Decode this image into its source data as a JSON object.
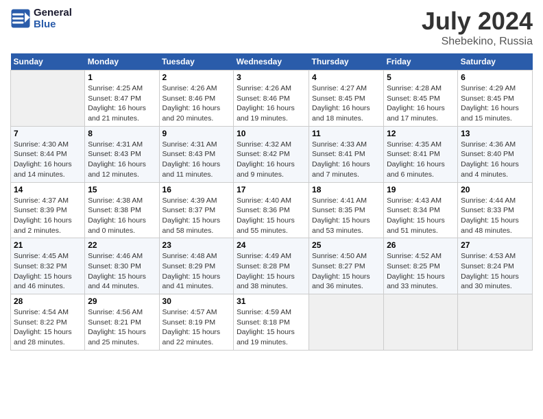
{
  "header": {
    "logo_line1": "General",
    "logo_line2": "Blue",
    "month": "July 2024",
    "location": "Shebekino, Russia"
  },
  "weekdays": [
    "Sunday",
    "Monday",
    "Tuesday",
    "Wednesday",
    "Thursday",
    "Friday",
    "Saturday"
  ],
  "weeks": [
    [
      {
        "day": "",
        "info": ""
      },
      {
        "day": "1",
        "info": "Sunrise: 4:25 AM\nSunset: 8:47 PM\nDaylight: 16 hours\nand 21 minutes."
      },
      {
        "day": "2",
        "info": "Sunrise: 4:26 AM\nSunset: 8:46 PM\nDaylight: 16 hours\nand 20 minutes."
      },
      {
        "day": "3",
        "info": "Sunrise: 4:26 AM\nSunset: 8:46 PM\nDaylight: 16 hours\nand 19 minutes."
      },
      {
        "day": "4",
        "info": "Sunrise: 4:27 AM\nSunset: 8:45 PM\nDaylight: 16 hours\nand 18 minutes."
      },
      {
        "day": "5",
        "info": "Sunrise: 4:28 AM\nSunset: 8:45 PM\nDaylight: 16 hours\nand 17 minutes."
      },
      {
        "day": "6",
        "info": "Sunrise: 4:29 AM\nSunset: 8:45 PM\nDaylight: 16 hours\nand 15 minutes."
      }
    ],
    [
      {
        "day": "7",
        "info": "Sunrise: 4:30 AM\nSunset: 8:44 PM\nDaylight: 16 hours\nand 14 minutes."
      },
      {
        "day": "8",
        "info": "Sunrise: 4:31 AM\nSunset: 8:43 PM\nDaylight: 16 hours\nand 12 minutes."
      },
      {
        "day": "9",
        "info": "Sunrise: 4:31 AM\nSunset: 8:43 PM\nDaylight: 16 hours\nand 11 minutes."
      },
      {
        "day": "10",
        "info": "Sunrise: 4:32 AM\nSunset: 8:42 PM\nDaylight: 16 hours\nand 9 minutes."
      },
      {
        "day": "11",
        "info": "Sunrise: 4:33 AM\nSunset: 8:41 PM\nDaylight: 16 hours\nand 7 minutes."
      },
      {
        "day": "12",
        "info": "Sunrise: 4:35 AM\nSunset: 8:41 PM\nDaylight: 16 hours\nand 6 minutes."
      },
      {
        "day": "13",
        "info": "Sunrise: 4:36 AM\nSunset: 8:40 PM\nDaylight: 16 hours\nand 4 minutes."
      }
    ],
    [
      {
        "day": "14",
        "info": "Sunrise: 4:37 AM\nSunset: 8:39 PM\nDaylight: 16 hours\nand 2 minutes."
      },
      {
        "day": "15",
        "info": "Sunrise: 4:38 AM\nSunset: 8:38 PM\nDaylight: 16 hours\nand 0 minutes."
      },
      {
        "day": "16",
        "info": "Sunrise: 4:39 AM\nSunset: 8:37 PM\nDaylight: 15 hours\nand 58 minutes."
      },
      {
        "day": "17",
        "info": "Sunrise: 4:40 AM\nSunset: 8:36 PM\nDaylight: 15 hours\nand 55 minutes."
      },
      {
        "day": "18",
        "info": "Sunrise: 4:41 AM\nSunset: 8:35 PM\nDaylight: 15 hours\nand 53 minutes."
      },
      {
        "day": "19",
        "info": "Sunrise: 4:43 AM\nSunset: 8:34 PM\nDaylight: 15 hours\nand 51 minutes."
      },
      {
        "day": "20",
        "info": "Sunrise: 4:44 AM\nSunset: 8:33 PM\nDaylight: 15 hours\nand 48 minutes."
      }
    ],
    [
      {
        "day": "21",
        "info": "Sunrise: 4:45 AM\nSunset: 8:32 PM\nDaylight: 15 hours\nand 46 minutes."
      },
      {
        "day": "22",
        "info": "Sunrise: 4:46 AM\nSunset: 8:30 PM\nDaylight: 15 hours\nand 44 minutes."
      },
      {
        "day": "23",
        "info": "Sunrise: 4:48 AM\nSunset: 8:29 PM\nDaylight: 15 hours\nand 41 minutes."
      },
      {
        "day": "24",
        "info": "Sunrise: 4:49 AM\nSunset: 8:28 PM\nDaylight: 15 hours\nand 38 minutes."
      },
      {
        "day": "25",
        "info": "Sunrise: 4:50 AM\nSunset: 8:27 PM\nDaylight: 15 hours\nand 36 minutes."
      },
      {
        "day": "26",
        "info": "Sunrise: 4:52 AM\nSunset: 8:25 PM\nDaylight: 15 hours\nand 33 minutes."
      },
      {
        "day": "27",
        "info": "Sunrise: 4:53 AM\nSunset: 8:24 PM\nDaylight: 15 hours\nand 30 minutes."
      }
    ],
    [
      {
        "day": "28",
        "info": "Sunrise: 4:54 AM\nSunset: 8:22 PM\nDaylight: 15 hours\nand 28 minutes."
      },
      {
        "day": "29",
        "info": "Sunrise: 4:56 AM\nSunset: 8:21 PM\nDaylight: 15 hours\nand 25 minutes."
      },
      {
        "day": "30",
        "info": "Sunrise: 4:57 AM\nSunset: 8:19 PM\nDaylight: 15 hours\nand 22 minutes."
      },
      {
        "day": "31",
        "info": "Sunrise: 4:59 AM\nSunset: 8:18 PM\nDaylight: 15 hours\nand 19 minutes."
      },
      {
        "day": "",
        "info": ""
      },
      {
        "day": "",
        "info": ""
      },
      {
        "day": "",
        "info": ""
      }
    ]
  ]
}
